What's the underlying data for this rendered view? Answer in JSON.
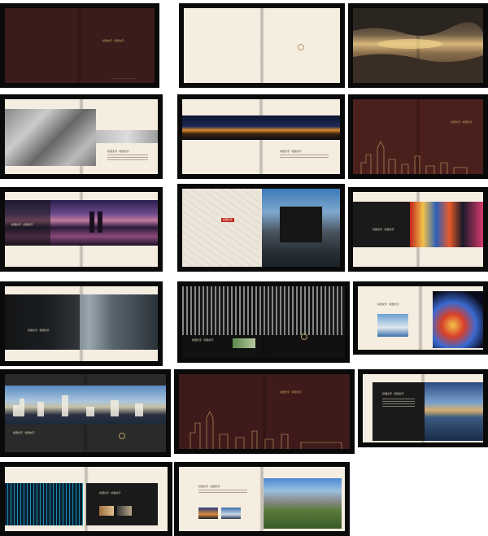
{
  "spreads": [
    {
      "id": "cover",
      "left_title": "",
      "right_title": "标题文字 · 标题文字",
      "footer": "——————————"
    },
    {
      "id": "intro-blank",
      "emblem": "emblem"
    },
    {
      "id": "sunset-harbor"
    },
    {
      "id": "old-city-photos",
      "caption": "标题文字 · 标题文字"
    },
    {
      "id": "night-bridge",
      "caption": "标题文字 · 标题文字"
    },
    {
      "id": "maroon-skyline",
      "caption": "标题文字 · 标题文字"
    },
    {
      "id": "twin-towers",
      "caption": "标题文字 · 标题文字"
    },
    {
      "id": "map-spread",
      "tag": "标题文字"
    },
    {
      "id": "times-square",
      "caption": "标题文字 · 标题文字"
    },
    {
      "id": "glass-towers",
      "caption": "标题文字 · 标题文字"
    },
    {
      "id": "office-night",
      "caption": "标题文字 · 标题文字"
    },
    {
      "id": "light-trails",
      "caption": "标题文字 · 标题文字"
    },
    {
      "id": "skyline-water",
      "caption": "标题文字 · 标题文字"
    },
    {
      "id": "maroon-city",
      "caption": "标题文字 · 标题文字"
    },
    {
      "id": "sea-city",
      "caption": "标题文字 · 标题文字"
    },
    {
      "id": "data-wall",
      "caption": "标题文字 · 标题文字"
    },
    {
      "id": "park-city",
      "caption": "标题文字 · 标题文字"
    }
  ],
  "colors": {
    "maroon": "#3a1a18",
    "cream": "#f4ecdc",
    "charcoal": "#2a2a2a",
    "gold": "#c8a96a",
    "frame": "#0a0a0a"
  }
}
